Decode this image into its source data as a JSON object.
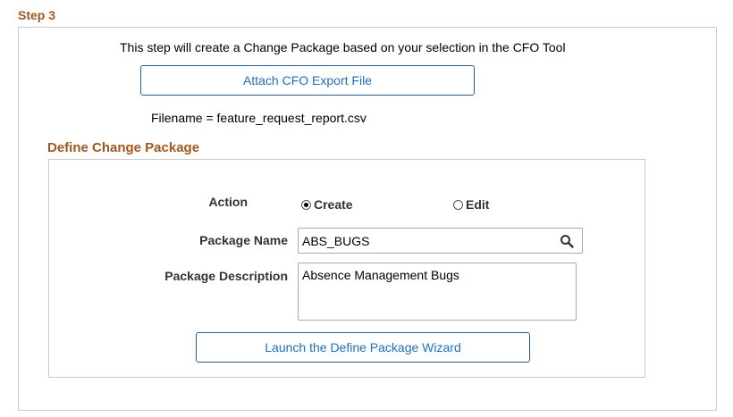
{
  "step": {
    "title": "Step 3"
  },
  "intro_text": "This step will create a Change Package based on your selection in the CFO Tool",
  "attach_button": {
    "label": "Attach CFO Export File"
  },
  "filename_text": "Filename = feature_request_report.csv",
  "define_section": {
    "title": "Define Change Package",
    "action": {
      "label": "Action",
      "options": [
        {
          "label": "Create",
          "selected": true
        },
        {
          "label": "Edit",
          "selected": false
        }
      ]
    },
    "package_name": {
      "label": "Package Name",
      "value": "ABS_BUGS",
      "icon": "search-icon"
    },
    "package_description": {
      "label": "Package Description",
      "value": "Absence Management Bugs"
    },
    "wizard_button": {
      "label": "Launch the Define Package Wizard"
    }
  },
  "colors": {
    "heading": "#a0561e",
    "button_text": "#1f6fbf",
    "button_border": "#2c5c8f"
  }
}
